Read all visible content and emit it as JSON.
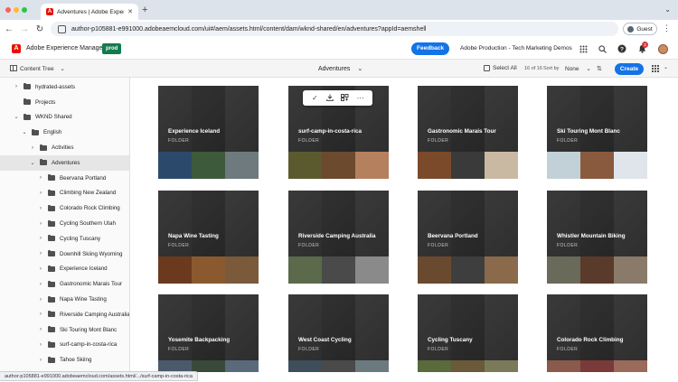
{
  "browser": {
    "tab_title": "Adventures | Adobe Experie",
    "url": "author-p105881-e991000.adobeaemcloud.com/ui#/aem/assets.html/content/dam/wknd-shared/en/adventures?appId=aemshell",
    "profile_label": "Guest",
    "traffic_lights": [
      "#fe5f57",
      "#febc2e",
      "#28c840"
    ]
  },
  "aem_header": {
    "product_name": "Adobe Experience Manager",
    "environment_badge": "prod",
    "feedback_label": "Feedback",
    "org_name": "Adobe Production - Tech Marketing Demos",
    "notification_count": "2",
    "accent_color": "#1473e6",
    "badge_color": "#137a4f"
  },
  "action_bar": {
    "rail_label": "Content Tree",
    "folder_title": "Adventures",
    "select_all_label": "Select All",
    "item_count": "16 of 16",
    "sort_label": "Sort by",
    "sort_value": "None",
    "create_label": "Create"
  },
  "tree": [
    {
      "label": "hydrated-assets",
      "chevron": "›"
    },
    {
      "label": "Projects",
      "chevron": ""
    },
    {
      "label": "WKND Shared",
      "chevron": "⌄"
    },
    {
      "label": "English",
      "chevron": "⌄"
    },
    {
      "label": "Activities",
      "chevron": "›"
    },
    {
      "label": "Adventures",
      "chevron": "⌄",
      "selected": true
    },
    {
      "label": "Beervana Portland",
      "chevron": "›"
    },
    {
      "label": "Climbing New Zealand",
      "chevron": "›"
    },
    {
      "label": "Colorado Rock Climbing",
      "chevron": "›"
    },
    {
      "label": "Cycling Southern Utah",
      "chevron": "›"
    },
    {
      "label": "Cycling Tuscany",
      "chevron": "›"
    },
    {
      "label": "Downhill Skiing Wyoming",
      "chevron": "›"
    },
    {
      "label": "Experience Iceland",
      "chevron": "›"
    },
    {
      "label": "Gastronomic Marais Tour",
      "chevron": "›"
    },
    {
      "label": "Napa Wine Tasting",
      "chevron": "›"
    },
    {
      "label": "Riverside Camping Australia",
      "chevron": "›"
    },
    {
      "label": "Ski Touring Mont Blanc",
      "chevron": "›"
    },
    {
      "label": "surf-camp-in-costa-rica",
      "chevron": "›"
    },
    {
      "label": "Tahoe Skiing",
      "chevron": "›"
    }
  ],
  "cards": [
    {
      "title": "Experience Iceland",
      "type": "FOLDER",
      "thumbs": [
        "#2b4a6b",
        "#3d5a3a",
        "#6e7a7e"
      ]
    },
    {
      "title": "surf-camp-in-costa-rica",
      "type": "FOLDER",
      "thumbs": [
        "#5a5a2e",
        "#6b4a2e",
        "#b5805e"
      ]
    },
    {
      "title": "Gastronomic Marais Tour",
      "type": "FOLDER",
      "thumbs": [
        "#7a4a2a",
        "#3a3a3a",
        "#c9b9a2"
      ]
    },
    {
      "title": "Ski Touring Mont Blanc",
      "type": "FOLDER",
      "thumbs": [
        "#c2d0d8",
        "#8a5a3e",
        "#dfe5ea"
      ]
    },
    {
      "title": "Napa Wine Tasting",
      "type": "FOLDER",
      "thumbs": [
        "#6b3a1e",
        "#8a5a2e",
        "#7a5a3a"
      ]
    },
    {
      "title": "Riverside Camping Australia",
      "type": "FOLDER",
      "thumbs": [
        "#5a6a4a",
        "#4a4a4a",
        "#8a8a8a"
      ]
    },
    {
      "title": "Beervana Portland",
      "type": "FOLDER",
      "thumbs": [
        "#6a4a2e",
        "#3e3e3e",
        "#8a6a4a"
      ]
    },
    {
      "title": "Whistler Mountain Biking",
      "type": "FOLDER",
      "thumbs": [
        "#6a6a5a",
        "#5a3a2a",
        "#8a7a6a"
      ]
    },
    {
      "title": "Yosemite Backpacking",
      "type": "FOLDER",
      "thumbs": [
        "#4a5a6a",
        "#3a4a3a",
        "#5a6a7a"
      ]
    },
    {
      "title": "West Coast Cycling",
      "type": "FOLDER",
      "thumbs": [
        "#3e4e5a",
        "#4a4a4a",
        "#6a7a7e"
      ]
    },
    {
      "title": "Cycling Tuscany",
      "type": "FOLDER",
      "thumbs": [
        "#5a6a3a",
        "#6a5a3a",
        "#7a7a5a"
      ]
    },
    {
      "title": "Colorado Rock Climbing",
      "type": "FOLDER",
      "thumbs": [
        "#8a5a4a",
        "#7a3a3a",
        "#9a6a5a"
      ]
    }
  ],
  "quick_actions": [
    "select-icon",
    "download-icon",
    "add-to-collection-icon",
    "more-icon"
  ],
  "status_bar": {
    "link_preview": "author-p105881-e991000.adobeaemcloud.com/assets.html/.../surf-camp-in-costa-rica"
  }
}
